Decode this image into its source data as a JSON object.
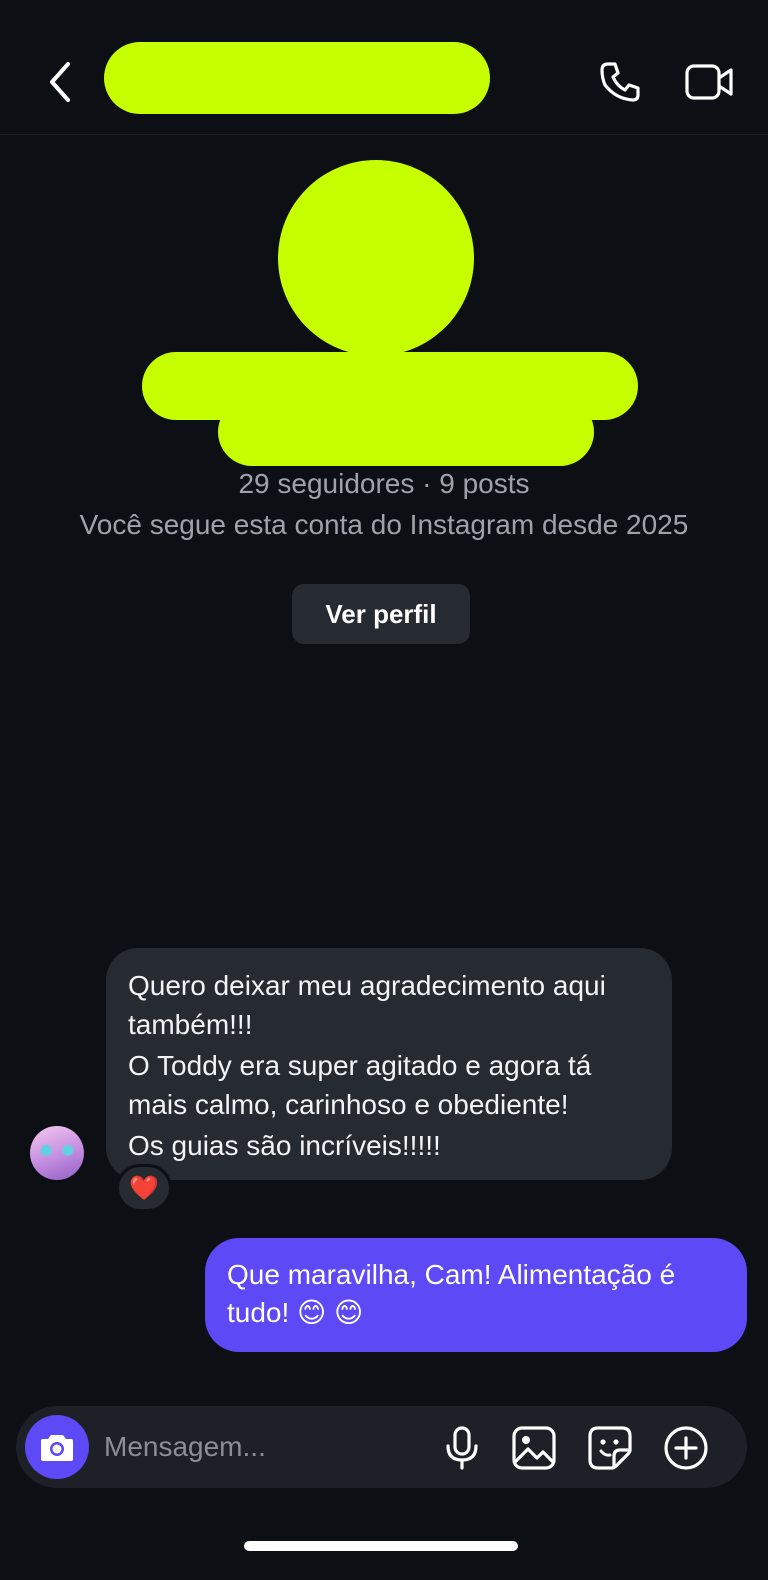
{
  "theme": {
    "accent": "#c6ff00",
    "outgoing": "#5d49f5"
  },
  "header": {
    "back_icon": "chevron-left-icon",
    "call_icon": "phone-icon",
    "video_icon": "video-camera-icon"
  },
  "profile": {
    "stats": "29 seguidores · 9 posts",
    "following_since": "Você segue esta conta do Instagram desde 2025",
    "view_profile_label": "Ver perfil"
  },
  "messages": [
    {
      "direction": "incoming",
      "lines": [
        "Quero deixar meu agradecimento aqui também!!!",
        "O Toddy era super agitado e agora tá mais calmo, carinhoso e obediente!",
        "Os guias são incríveis!!!!!"
      ],
      "reaction": "❤️"
    },
    {
      "direction": "outgoing",
      "text": "Que maravilha, Cam! Alimentação é tudo! 😊 😊"
    }
  ],
  "composer": {
    "placeholder": "Mensagem...",
    "icons": [
      "camera-icon",
      "microphone-icon",
      "gallery-icon",
      "sticker-icon",
      "plus-circle-icon"
    ]
  }
}
